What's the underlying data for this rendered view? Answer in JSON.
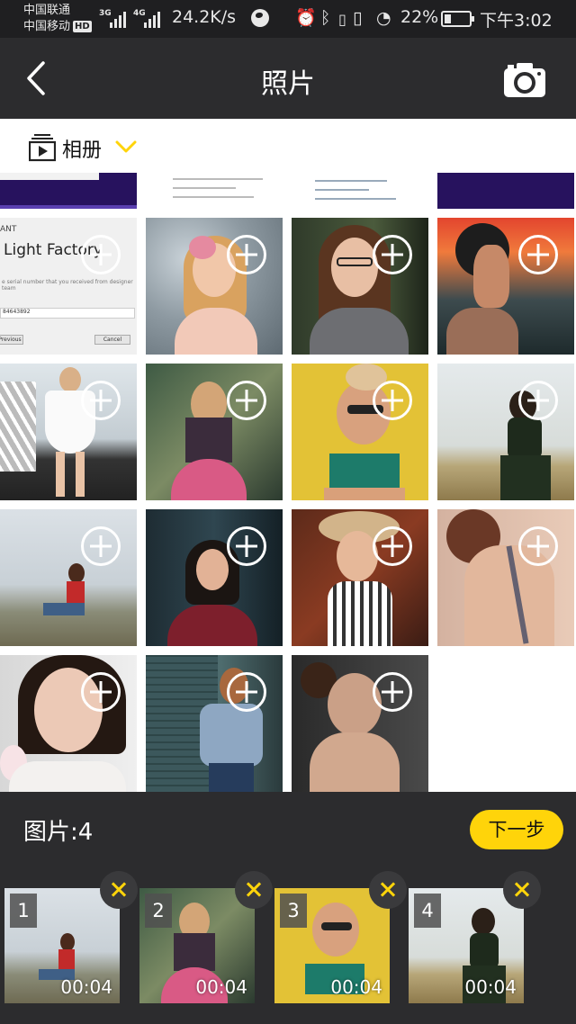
{
  "status_bar": {
    "carrier_1": "中国联通",
    "carrier_2": "中国移动",
    "hd_badge": "HD",
    "net_1": "3G",
    "net_2": "4G",
    "speed": "24.2K/s",
    "battery_percent": "22%",
    "time": "下午3:02",
    "icons": [
      "signal-icon",
      "globe-icon",
      "alarm-icon",
      "bluetooth-icon",
      "vibrate-icon",
      "speedometer-icon",
      "battery-icon"
    ]
  },
  "header": {
    "title": "照片",
    "back_icon": "chevron-left-icon",
    "camera_icon": "camera-icon"
  },
  "album": {
    "label": "相册",
    "icon": "album-play-icon",
    "caret_icon": "chevron-down-icon",
    "accent_color": "#ffd40a"
  },
  "grid": {
    "add_icon": "plus-circle-icon",
    "dialog_tile": {
      "tag": "ANT",
      "heading": "Light Factory",
      "note": "e serial number that you received from designer team",
      "field_value": "84643892",
      "left_button": "Previous",
      "right_button": "Cancel"
    }
  },
  "selection": {
    "count_label": "图片:4",
    "next_button": "下一步",
    "remove_icon": "close-x-icon",
    "items": [
      {
        "index": "1",
        "duration": "00:04"
      },
      {
        "index": "2",
        "duration": "00:04"
      },
      {
        "index": "3",
        "duration": "00:04"
      },
      {
        "index": "4",
        "duration": "00:04"
      }
    ]
  }
}
